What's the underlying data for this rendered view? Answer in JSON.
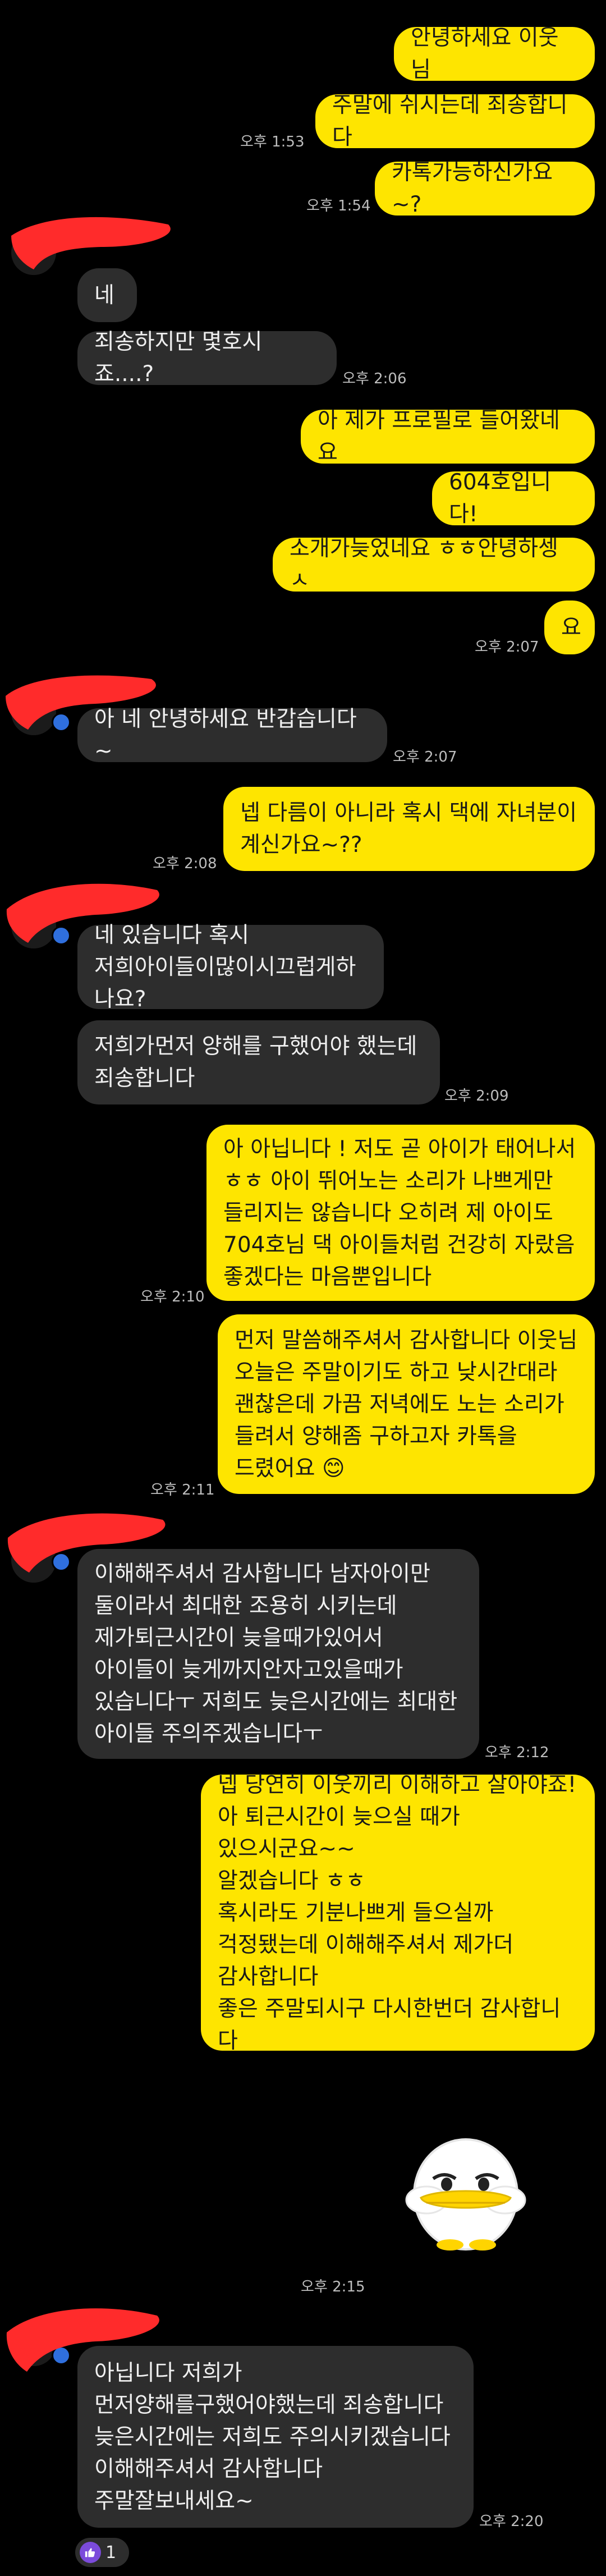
{
  "colors": {
    "background": "#000000",
    "my_bubble": "#FEE500",
    "their_bubble": "#2D2D2D",
    "time_text": "#BDBDBD",
    "redaction": "#FF2B2B"
  },
  "messages": [
    {
      "side": "me",
      "text": "안녕하세요 이웃님"
    },
    {
      "side": "me",
      "text": "주말에 쉬시는데 죄송합니다",
      "time": "오후 1:53"
    },
    {
      "side": "me",
      "text": "카톡가능하신가요~?",
      "time": "오후 1:54"
    },
    {
      "side": "them",
      "text": "네"
    },
    {
      "side": "them",
      "text": "죄송하지만 몇호시죠....?",
      "time": "오후 2:06"
    },
    {
      "side": "me",
      "text": "아 제가 프로필로 들어왔네요"
    },
    {
      "side": "me",
      "text": "604호입니다!"
    },
    {
      "side": "me",
      "text": "소개가늦었네요 ㅎㅎ안녕하셍ㅅ"
    },
    {
      "side": "me",
      "text": "요",
      "time": "오후 2:07"
    },
    {
      "side": "them",
      "text": "아 네 안녕하세요 반갑습니다~",
      "time": "오후 2:07"
    },
    {
      "side": "me",
      "text": "넵 다름이 아니라 혹시 댁에 자녀분이\n계신가요~??",
      "time": "오후 2:08"
    },
    {
      "side": "them",
      "text": "네 있습니다 혹시\n저희아이들이많이시끄럽게하나요?"
    },
    {
      "side": "them",
      "text": "저희가먼저 양해를 구했어야 했는데\n죄송합니다",
      "time": "오후 2:09"
    },
    {
      "side": "me",
      "text": "아 아닙니다 ! 저도 곧 아이가 태어나서\nㅎㅎ 아이 뛰어노는 소리가 나쁘게만\n들리지는 않습니다 오히려 제 아이도\n704호님 댁 아이들처럼 건강히 자랐음\n좋겠다는 마음뿐입니다",
      "time": "오후 2:10"
    },
    {
      "side": "me",
      "text": "먼저 말씀해주셔서 감사합니다 이웃님\n오늘은 주말이기도 하고 낮시간대라\n괜찮은데 가끔 저녁에도 노는 소리가\n들려서 양해좀 구하고자 카톡을\n드렸어요 😊",
      "time": "오후 2:11"
    },
    {
      "side": "them",
      "text": "이해해주셔서 감사합니다 남자아이만\n둘이라서 최대한 조용히 시키는데\n제가퇴근시간이 늦을때가있어서\n아이들이 늦게까지안자고있을때가\n있습니다ㅜ 저희도 늦은시간에는 최대한\n아이들 주의주겠습니다ㅜ",
      "time": "오후 2:12"
    },
    {
      "side": "me",
      "text": "넵 당연히 이웃끼리 이해하고 살아야죠!\n아 퇴근시간이 늦으실 때가\n있으시군요~~\n알겠습니다 ㅎㅎ\n혹시라도 기분나쁘게 들으실까\n걱정됐는데 이해해주셔서 제가더\n감사합니다\n좋은 주말되시구 다시한번더 감사합니다"
    },
    {
      "side": "me",
      "sticker": "duck-sticker",
      "time": "오후 2:15"
    },
    {
      "side": "them",
      "text": "아닙니다 저희가\n먼저양해를구했어야했는데 죄송합니다\n늦은시간에는 저희도 주의시키겠습니다\n이해해주셔서 감사합니다\n주말잘보내세요~",
      "time": "오후 2:20",
      "reaction": {
        "icon": "thumbs-up-icon",
        "count": "1"
      }
    }
  ]
}
